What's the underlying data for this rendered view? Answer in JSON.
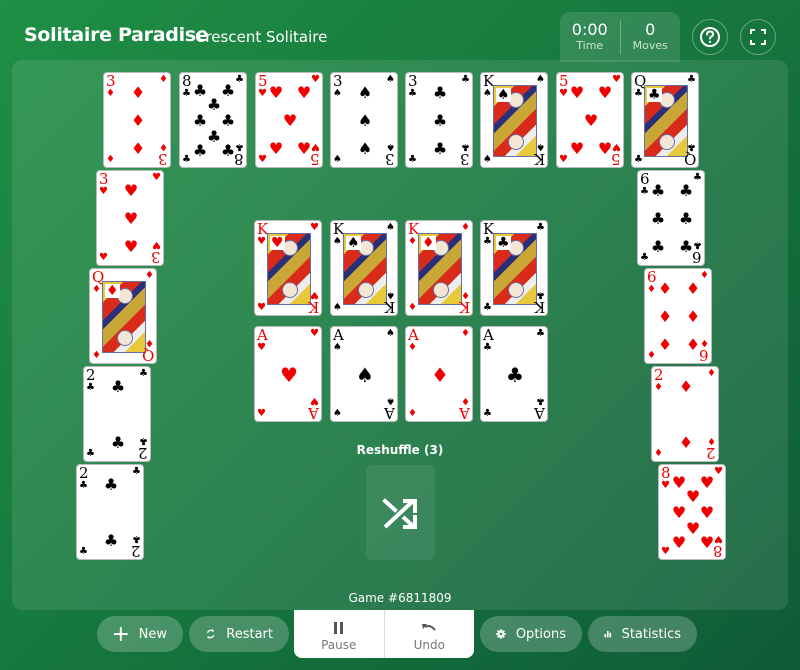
{
  "header": {
    "brand": "Solitaire Paradise",
    "game_name": "Crescent Solitaire",
    "time_value": "0:00",
    "time_label": "Time",
    "moves_value": "0",
    "moves_label": "Moves",
    "help_icon": "question-circle-icon",
    "fullscreen_icon": "fullscreen-icon"
  },
  "cards": {
    "top_row": [
      {
        "rank": "3",
        "suit": "♦",
        "color": "red"
      },
      {
        "rank": "8",
        "suit": "♣",
        "color": "black"
      },
      {
        "rank": "5",
        "suit": "♥",
        "color": "red"
      },
      {
        "rank": "3",
        "suit": "♠",
        "color": "black"
      },
      {
        "rank": "3",
        "suit": "♣",
        "color": "black"
      },
      {
        "rank": "K",
        "suit": "♠",
        "color": "black"
      },
      {
        "rank": "5",
        "suit": "♥",
        "color": "red"
      },
      {
        "rank": "Q",
        "suit": "♣",
        "color": "black"
      }
    ],
    "left_column": [
      {
        "rank": "3",
        "suit": "♥",
        "color": "red"
      },
      {
        "rank": "Q",
        "suit": "♦",
        "color": "red"
      },
      {
        "rank": "2",
        "suit": "♣",
        "color": "black"
      },
      {
        "rank": "2",
        "suit": "♣",
        "color": "black"
      }
    ],
    "right_column": [
      {
        "rank": "6",
        "suit": "♣",
        "color": "black"
      },
      {
        "rank": "6",
        "suit": "♦",
        "color": "red"
      },
      {
        "rank": "2",
        "suit": "♦",
        "color": "red"
      },
      {
        "rank": "8",
        "suit": "♥",
        "color": "red"
      }
    ],
    "foundation_kings": [
      {
        "rank": "K",
        "suit": "♥",
        "color": "red"
      },
      {
        "rank": "K",
        "suit": "♠",
        "color": "black"
      },
      {
        "rank": "K",
        "suit": "♦",
        "color": "red"
      },
      {
        "rank": "K",
        "suit": "♣",
        "color": "black"
      }
    ],
    "foundation_aces": [
      {
        "rank": "A",
        "suit": "♥",
        "color": "red"
      },
      {
        "rank": "A",
        "suit": "♠",
        "color": "black"
      },
      {
        "rank": "A",
        "suit": "♦",
        "color": "red"
      },
      {
        "rank": "A",
        "suit": "♣",
        "color": "black"
      }
    ]
  },
  "reshuffle": {
    "label": "Reshuffle (3)",
    "icon": "shuffle-icon"
  },
  "game_number": "Game #6811809",
  "toolbar": {
    "new_label": "New",
    "restart_label": "Restart",
    "pause_label": "Pause",
    "undo_label": "Undo",
    "options_label": "Options",
    "statistics_label": "Statistics"
  },
  "colors": {
    "red_suit": "#ee0000",
    "black_suit": "#000000",
    "felt": "#1a8040"
  }
}
